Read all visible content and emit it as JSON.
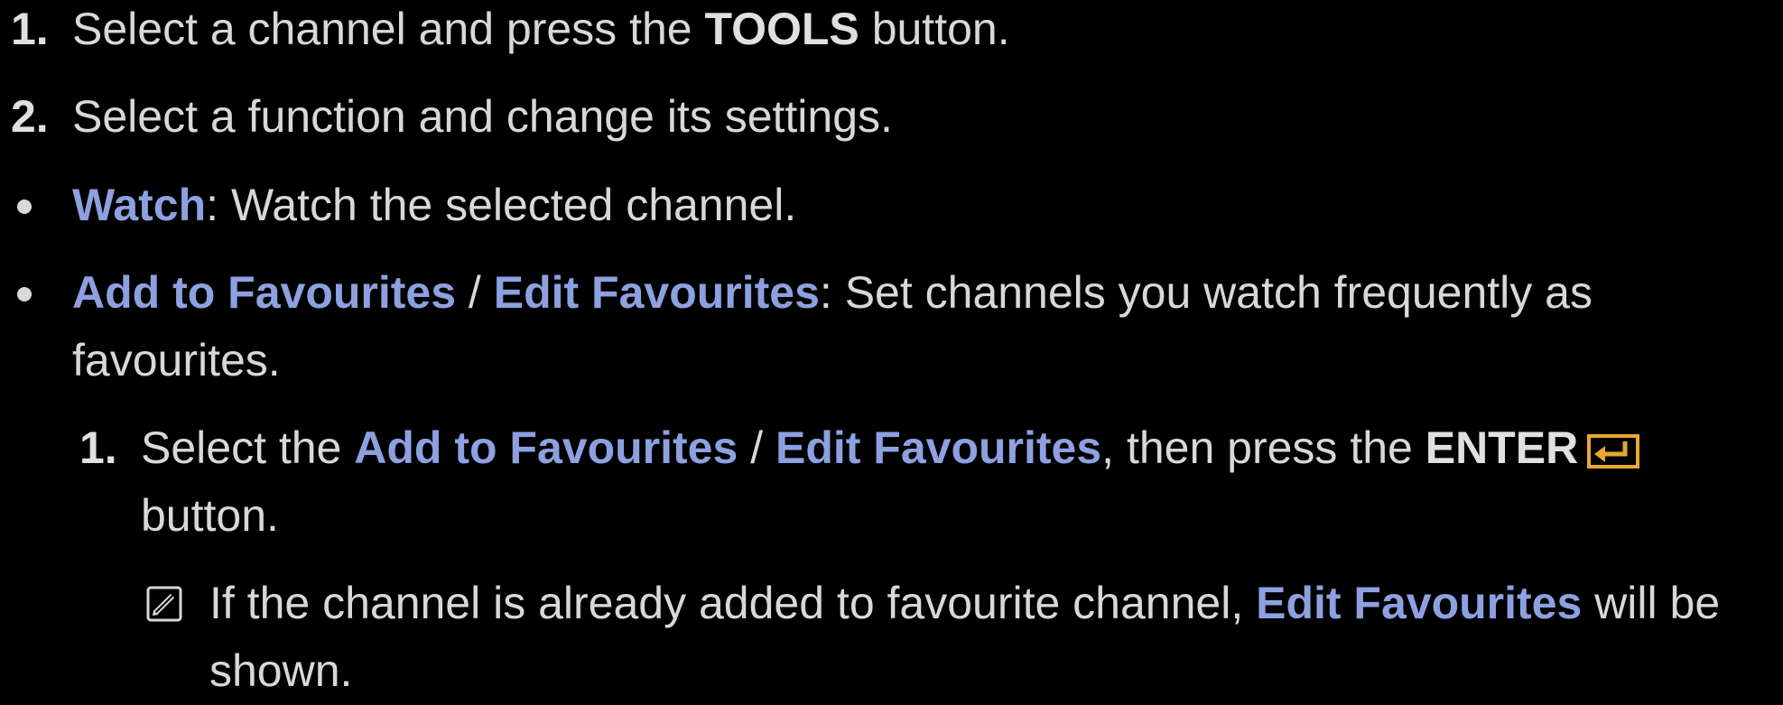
{
  "step1": {
    "number": "1.",
    "text_before": "Select a channel and press the ",
    "key": "TOOLS",
    "text_after": " button."
  },
  "step2": {
    "number": "2.",
    "text": "Select a function and change its settings."
  },
  "bullet_watch": {
    "label": "Watch",
    "text": ": Watch the selected channel."
  },
  "bullet_favourites": {
    "label_add": "Add to Favourites",
    "separator": " / ",
    "label_edit": "Edit Favourites",
    "text_line1": ": Set channels you watch frequently as",
    "text_line2": "favourites."
  },
  "substep1": {
    "number": "1.",
    "text_before": "Select the ",
    "label_add": "Add to Favourites",
    "separator": " / ",
    "label_edit": "Edit Favourites",
    "text_mid": ", then press the ",
    "key": "ENTER",
    "text_line2": "button."
  },
  "note": {
    "text_before": "If the channel is already added to favourite channel, ",
    "label_edit": "Edit Favourites",
    "text_after": " will be",
    "text_line2": "shown."
  },
  "colors": {
    "background": "#000000",
    "text": "#d8d8d8",
    "highlight": "#8da0e0",
    "enter_icon": "#e8a830"
  },
  "icons": {
    "enter": "enter-key-icon",
    "note": "note-pencil-icon"
  }
}
